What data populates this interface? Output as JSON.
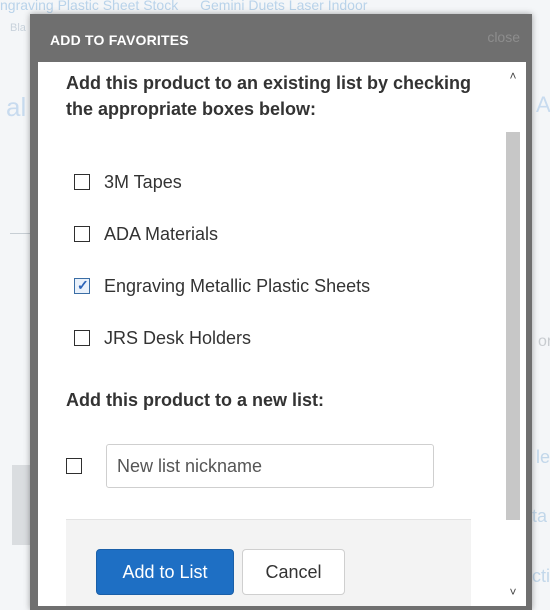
{
  "background": {
    "breadcrumbs": [
      "ngraving Plastic Sheet Stock",
      "Gemini Duets Laser Indoor"
    ],
    "sub_text": "Bla",
    "left_glyph": "al",
    "right_glyph": "A",
    "right_fragments": [
      "or",
      "le",
      "ta",
      "cti"
    ]
  },
  "dialog": {
    "title": "ADD TO FAVORITES",
    "close_label": "close",
    "intro": "Add this product to an existing list by checking the appropriate boxes below:",
    "lists": [
      {
        "label": "3M Tapes",
        "checked": false
      },
      {
        "label": "ADA Materials",
        "checked": false
      },
      {
        "label": "Engraving Metallic Plastic Sheets",
        "checked": true
      },
      {
        "label": "JRS Desk Holders",
        "checked": false
      }
    ],
    "new_list_title": "Add this product to a new list:",
    "new_list_placeholder": "New list nickname",
    "new_list_value": "",
    "add_button": "Add to List",
    "cancel_button": "Cancel"
  },
  "scrollbar": {
    "up_icon": "chevron-up-icon",
    "down_icon": "chevron-down-icon"
  },
  "colors": {
    "header_bg": "#6f6f6f",
    "primary": "#1e6fc4",
    "checkbox_check": "#2b63b8",
    "text": "#333333"
  }
}
